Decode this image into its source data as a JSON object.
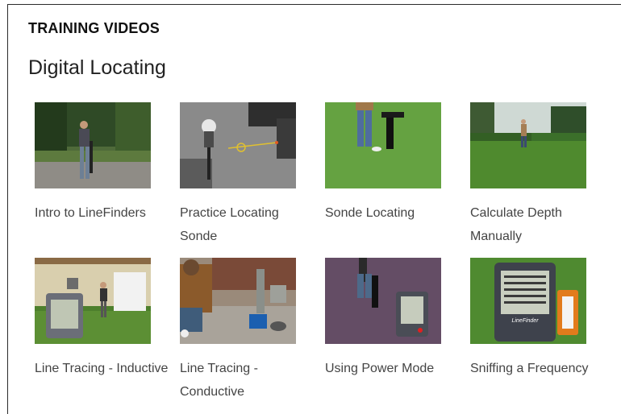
{
  "section": {
    "title": "TRAINING VIDEOS"
  },
  "category": {
    "title": "Digital Locating"
  },
  "videos": [
    {
      "title": "Intro to LineFinders"
    },
    {
      "title": "Practice Locating Sonde"
    },
    {
      "title": "Sonde Locating"
    },
    {
      "title": "Calculate Depth Manually"
    },
    {
      "title": "Line Tracing - Inductive"
    },
    {
      "title": "Line Tracing - Conductive"
    },
    {
      "title": "Using Power Mode"
    },
    {
      "title": "Sniffing a Frequency"
    }
  ],
  "thumbnail_texts": {
    "brand": "LineFinder"
  }
}
